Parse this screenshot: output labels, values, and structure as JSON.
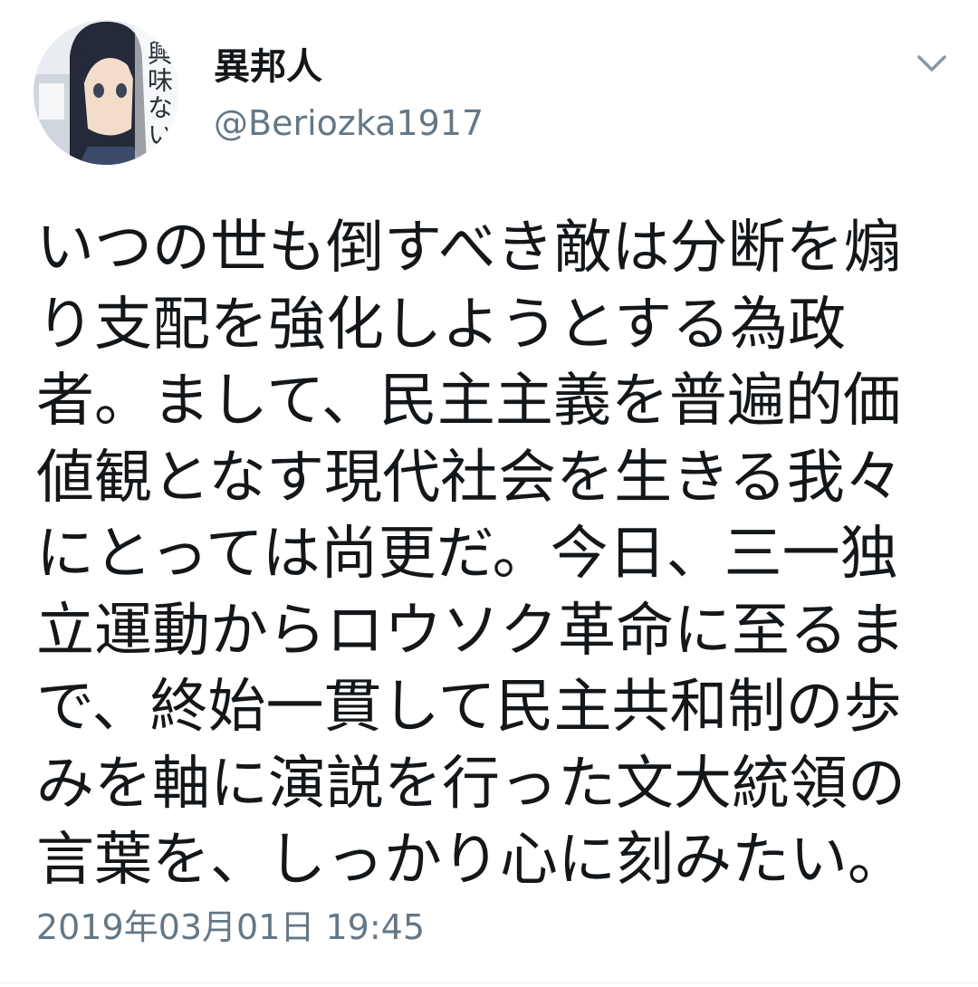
{
  "tweet": {
    "author": {
      "display_name": "異邦人",
      "handle": "@Beriozka1917",
      "avatar_text": "興味ない"
    },
    "menu_icon": "chevron-down-icon",
    "text": "いつの世も倒すべき敵は分断を煽り支配を強化しようとする為政者。まして、民主主義を普遍的価値観となす現代社会を生きる我々にとっては尚更だ。今日、三一独立運動からロウソク革命に至るまで、終始一貫して民主共和制の歩みを軸に演説を行った文大統領の言葉を、しっかり心に刻みたい。",
    "timestamp": "2019年03月01日 19:45"
  },
  "colors": {
    "text_primary": "#14171a",
    "text_secondary": "#657786",
    "divider": "#e6ecf0"
  }
}
